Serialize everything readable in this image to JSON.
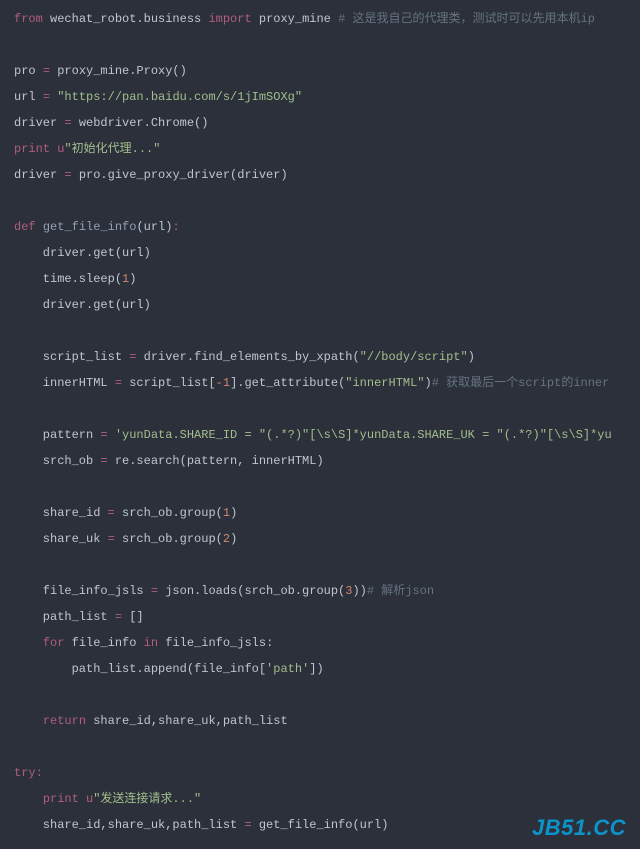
{
  "code": {
    "l1": {
      "from": "from",
      "mod1": " wechat_robot.business ",
      "imp": "import",
      "mod2": " proxy_mine ",
      "cmt": "# 这是我自己的代理类，测试时可以先用本机ip"
    },
    "l2": "",
    "l3": {
      "a": "pro ",
      "op": "=",
      "b": " proxy_mine.Proxy()"
    },
    "l4": {
      "a": "url ",
      "op": "=",
      "b": " ",
      "s": "\"https://pan.baidu.com/s/1jImSOXg\""
    },
    "l5": {
      "a": "driver ",
      "op": "=",
      "b": " webdriver.Chrome()"
    },
    "l6": {
      "p": "print",
      "sp": " ",
      "u": "u",
      "s": "\"初始化代理...\""
    },
    "l7": {
      "a": "driver ",
      "op": "=",
      "b": " pro.give_proxy_driver(driver)"
    },
    "l8": "",
    "l9": {
      "def": "def",
      "sp": " ",
      "name": "get_file_info",
      "open": "(url)",
      "colon": ":"
    },
    "l10": "    driver.get(url)",
    "l11": {
      "a": "    time.sleep(",
      "n": "1",
      "b": ")"
    },
    "l12": "    driver.get(url)",
    "l13": "",
    "l14": {
      "a": "    script_list ",
      "op": "=",
      "b": " driver.find_elements_by_xpath(",
      "s": "\"//body/script\"",
      "c": ")"
    },
    "l15": {
      "a": "    innerHTML ",
      "op": "=",
      "b": " script_list[",
      "n": "-1",
      "c": "].get_attribute(",
      "s": "\"innerHTML\"",
      "d": ")",
      "cmt": "# 获取最后一个script的inner"
    },
    "l16": "",
    "l17": {
      "a": "    pattern ",
      "op": "=",
      "b": " ",
      "s": "'yunData.SHARE_ID = \"(.*?)\"[\\s\\S]*yunData.SHARE_UK = \"(.*?)\"[\\s\\S]*yu"
    },
    "l18": {
      "a": "    srch_ob ",
      "op": "=",
      "b": " re.search(pattern, innerHTML)"
    },
    "l19": "",
    "l20": {
      "a": "    share_id ",
      "op": "=",
      "b": " srch_ob.group(",
      "n": "1",
      "c": ")"
    },
    "l21": {
      "a": "    share_uk ",
      "op": "=",
      "b": " srch_ob.group(",
      "n": "2",
      "c": ")"
    },
    "l22": "",
    "l23": {
      "a": "    file_info_jsls ",
      "op": "=",
      "b": " json.loads(srch_ob.group(",
      "n": "3",
      "c": "))",
      "cmt": "# 解析json"
    },
    "l24": {
      "a": "    path_list ",
      "op": "=",
      "b": " []"
    },
    "l25": {
      "a": "    ",
      "for": "for",
      "b": " file_info ",
      "in": "in",
      "c": " file_info_jsls:"
    },
    "l26": {
      "a": "        path_list.append(file_info[",
      "s": "'path'",
      "b": "])"
    },
    "l27": "",
    "l28": {
      "a": "    ",
      "ret": "return",
      "b": " share_id,share_uk,path_list"
    },
    "l29": "",
    "l30": {
      "try": "try",
      "colon": ":"
    },
    "l31": {
      "a": "    ",
      "p": "print",
      "sp": " ",
      "u": "u",
      "s": "\"发送连接请求...\""
    },
    "l32": {
      "a": "    share_id,share_uk,path_list ",
      "op": "=",
      "b": " get_file_info(url)"
    }
  },
  "watermark": "JB51.CC"
}
